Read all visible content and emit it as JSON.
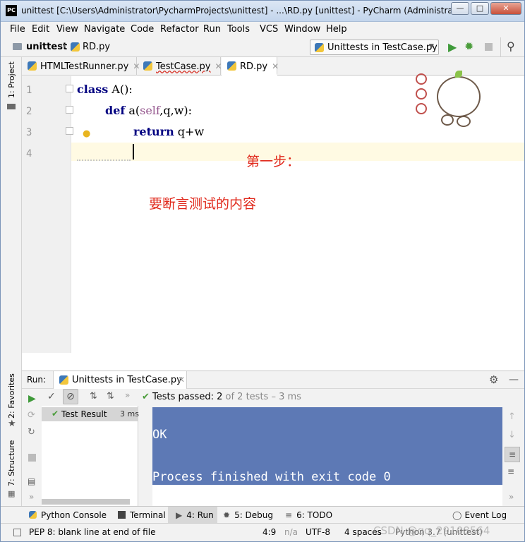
{
  "window": {
    "title": "unittest [C:\\Users\\Administrator\\PycharmProjects\\unittest] - ...\\RD.py [unittest] - PyCharm (Administrat...",
    "app_icon": "PC"
  },
  "menu": [
    "File",
    "Edit",
    "View",
    "Navigate",
    "Code",
    "Refactor",
    "Run",
    "Tools",
    "VCS",
    "Window",
    "Help"
  ],
  "breadcrumb": {
    "project": "unittest",
    "file": "RD.py"
  },
  "run_config": {
    "label": "Unittests in TestCase.py"
  },
  "editor_tabs": [
    {
      "label": "HTMLTestRunner.py"
    },
    {
      "label": "TestCase.py"
    },
    {
      "label": "RD.py"
    }
  ],
  "side_tools": {
    "project": "1: Project",
    "favorites": "2: Favorites",
    "structure": "7: Structure"
  },
  "code": {
    "line_numbers": [
      "1",
      "2",
      "3",
      "4"
    ],
    "l1_kw": "class",
    "l1_rest": " A():",
    "l2_kw": "def",
    "l2_a": " a(",
    "l2_self": "self",
    "l2_rest": ",q,w):",
    "l3_kw": "return",
    "l3_rest": " q+w"
  },
  "annotations": {
    "step": "第一步：",
    "note": "要断言测试的内容"
  },
  "run_panel": {
    "label": "Run:",
    "tab": "Unittests in TestCase.py",
    "tests_passed_prefix": "Tests passed:",
    "tests_passed_count": "2",
    "tests_passed_suffix": "of 2 tests – 3 ms",
    "result_item": "Test Result",
    "result_time": "3 ms",
    "console_lines": [
      "OK",
      "Process finished with exit code 0"
    ]
  },
  "bottom_tools": [
    "Python Console",
    "Terminal",
    "4: Run",
    "5: Debug",
    "6: TODO",
    "Event Log"
  ],
  "status": {
    "message": "PEP 8: blank line at end of file",
    "position": "4:9",
    "na": "n/a",
    "encoding": "UTF-8",
    "indent": "4 spaces",
    "interpreter": "Python 3.7 (unittest)",
    "watermark": "CSDN @qq_29108564"
  },
  "colors": {
    "console_bg": "#5d79b5",
    "annotation": "#e0281b",
    "keyword": "#000080",
    "success": "#4a9c3a"
  }
}
